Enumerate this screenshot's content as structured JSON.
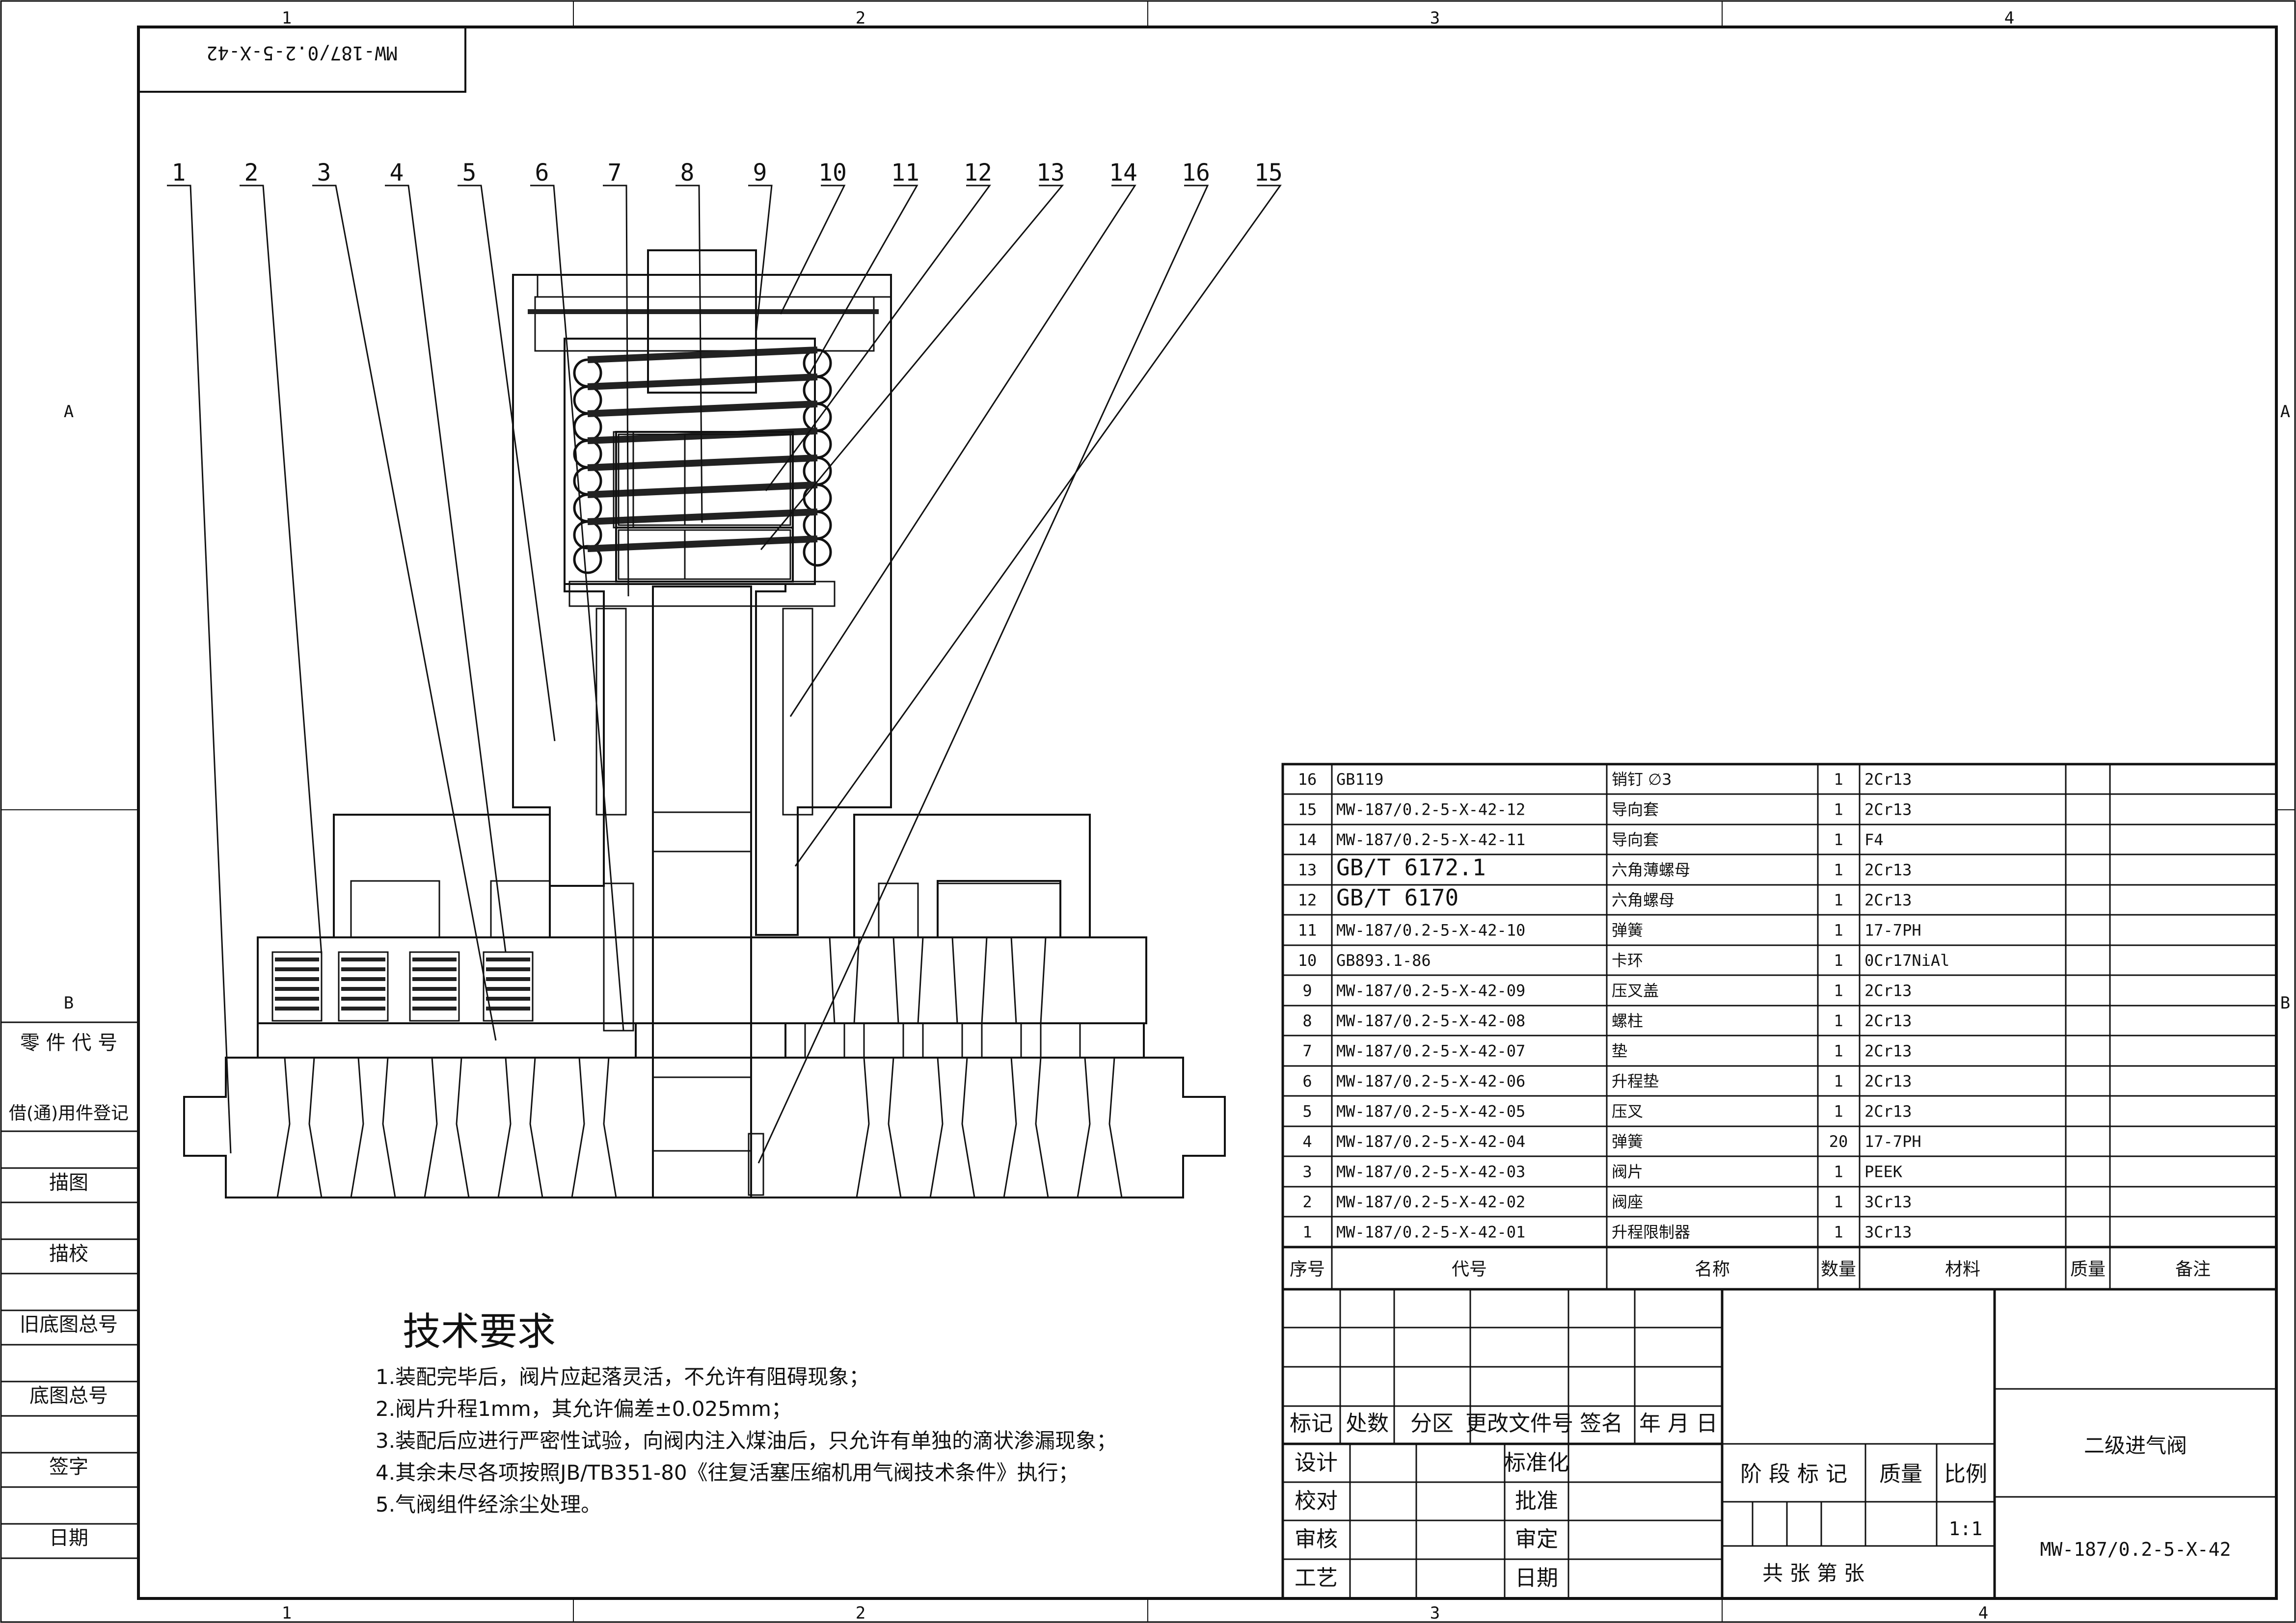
{
  "drawing_number_box": "MW-187/0.2-5-X-42",
  "zone_columns": [
    "1",
    "2",
    "3",
    "4"
  ],
  "zone_rows": [
    "A",
    "B"
  ],
  "balloons": [
    "1",
    "2",
    "3",
    "4",
    "5",
    "6",
    "7",
    "8",
    "9",
    "10",
    "11",
    "12",
    "13",
    "14",
    "16",
    "15"
  ],
  "side_panel": [
    "零 件 代 号",
    "借(通)用件登记",
    "描图",
    "描校",
    "旧底图总号",
    "底图总号",
    "签字",
    "日期"
  ],
  "notes": {
    "title": "技术要求",
    "lines": [
      "1.装配完毕后，阀片应起落灵活，不允许有阻碍现象；",
      "2.阀片升程1mm，其允许偏差±0.025mm；",
      "3.装配后应进行严密性试验，向阀内注入煤油后，只允许有单独的滴状渗漏现象；",
      "4.其余未尽各项按照JB/TB351-80《往复活塞压缩机用气阀技术条件》执行；",
      "5.气阀组件经涂尘处理。"
    ]
  },
  "bom": {
    "headers": [
      "序号",
      "代号",
      "名称",
      "数量",
      "材料",
      "质量",
      "备注"
    ],
    "rows": [
      {
        "no": "16",
        "code": "GB119",
        "name": "销钉 ∅3",
        "qty": "1",
        "mat": "2Cr13"
      },
      {
        "no": "15",
        "code": "MW-187/0.2-5-X-42-12",
        "name": "导向套",
        "qty": "1",
        "mat": "2Cr13"
      },
      {
        "no": "14",
        "code": "MW-187/0.2-5-X-42-11",
        "name": "导向套",
        "qty": "1",
        "mat": "F4"
      },
      {
        "no": "13",
        "code": "GB/T 6172.1",
        "name": "六角薄螺母",
        "qty": "1",
        "mat": "2Cr13"
      },
      {
        "no": "12",
        "code": "GB/T 6170",
        "name": "六角螺母",
        "qty": "1",
        "mat": "2Cr13"
      },
      {
        "no": "11",
        "code": "MW-187/0.2-5-X-42-10",
        "name": "弹簧",
        "qty": "1",
        "mat": "17-7PH"
      },
      {
        "no": "10",
        "code": "GB893.1-86",
        "name": "卡环",
        "qty": "1",
        "mat": "0Cr17NiAl"
      },
      {
        "no": "9",
        "code": "MW-187/0.2-5-X-42-09",
        "name": "压叉盖",
        "qty": "1",
        "mat": "2Cr13"
      },
      {
        "no": "8",
        "code": "MW-187/0.2-5-X-42-08",
        "name": "螺柱",
        "qty": "1",
        "mat": "2Cr13"
      },
      {
        "no": "7",
        "code": "MW-187/0.2-5-X-42-07",
        "name": "垫",
        "qty": "1",
        "mat": "2Cr13"
      },
      {
        "no": "6",
        "code": "MW-187/0.2-5-X-42-06",
        "name": "升程垫",
        "qty": "1",
        "mat": "2Cr13"
      },
      {
        "no": "5",
        "code": "MW-187/0.2-5-X-42-05",
        "name": "压叉",
        "qty": "1",
        "mat": "2Cr13"
      },
      {
        "no": "4",
        "code": "MW-187/0.2-5-X-42-04",
        "name": "弹簧",
        "qty": "20",
        "mat": "17-7PH"
      },
      {
        "no": "3",
        "code": "MW-187/0.2-5-X-42-03",
        "name": "阀片",
        "qty": "1",
        "mat": "PEEK"
      },
      {
        "no": "2",
        "code": "MW-187/0.2-5-X-42-02",
        "name": "阀座",
        "qty": "1",
        "mat": "3Cr13"
      },
      {
        "no": "1",
        "code": "MW-187/0.2-5-X-42-01",
        "name": "升程限制器",
        "qty": "1",
        "mat": "3Cr13"
      }
    ]
  },
  "title_block": {
    "revision_headers": [
      "标记",
      "处数",
      "分区",
      "更改文件号",
      "签名",
      "年 月 日"
    ],
    "sign_left": [
      "设计",
      "校对",
      "审核",
      "工艺"
    ],
    "sign_mid": [
      "标准化",
      "批准",
      "审定",
      "日期"
    ],
    "stage_label": "阶 段 标 记",
    "mass_label": "质量",
    "scale_label": "比例",
    "scale_value": "1:1",
    "sheets_label": "共  张       第  张",
    "title": "二级进气阀",
    "drawing_no": "MW-187/0.2-5-X-42"
  },
  "colors": {
    "line": "#111111",
    "plate_blue": "#1f4fb5",
    "part_lilac": "#d9d0e6",
    "hex_gray": "#8f8a92",
    "spring_dark": "#222222"
  }
}
